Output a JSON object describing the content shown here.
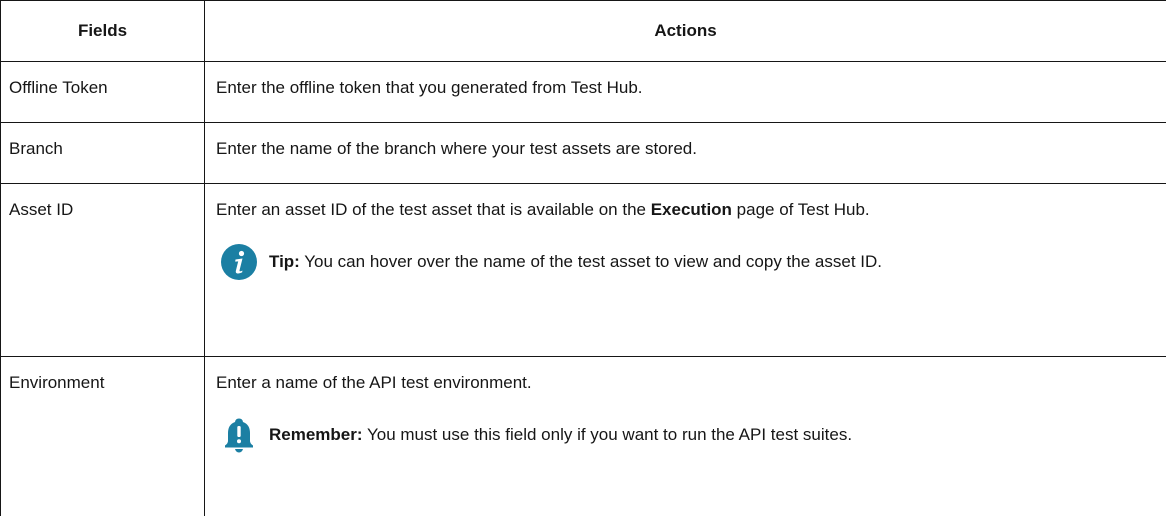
{
  "table": {
    "headers": [
      "Fields",
      "Actions"
    ],
    "rows": [
      {
        "field": "Offline Token",
        "action": "Enter the offline token that you generated from Test Hub."
      },
      {
        "field": "Branch",
        "action": "Enter the name of the branch where your test assets are stored."
      },
      {
        "field": "Asset ID",
        "action_before": "Enter an asset ID of the test asset that is available on the ",
        "action_bold": "Execution",
        "action_after": " page of Test Hub.",
        "note": {
          "icon": "info-icon",
          "label": "Tip:",
          "text": " You can hover over the name of the test asset to view and copy the asset ID."
        }
      },
      {
        "field": "Environment",
        "action": "Enter a name of the API test environment.",
        "note": {
          "icon": "bell-icon",
          "label": "Remember:",
          "text": " You must use this field only if you want to run the API test suites."
        }
      }
    ]
  },
  "colors": {
    "icon": "#1b7fa3",
    "border": "#161616",
    "text": "#161616"
  }
}
